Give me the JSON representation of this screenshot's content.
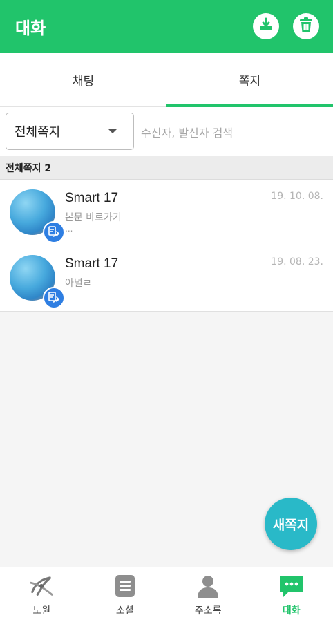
{
  "app_bar": {
    "title": "대화",
    "actions": [
      {
        "name": "download-icon"
      },
      {
        "name": "trash-icon"
      }
    ]
  },
  "tabs": [
    {
      "label": "채팅",
      "active": false
    },
    {
      "label": "쪽지",
      "active": true
    }
  ],
  "filter": {
    "dropdown_value": "전체쪽지",
    "search_placeholder": "수신자, 발신자 검색",
    "search_value": ""
  },
  "section": {
    "label": "전체쪽지 2"
  },
  "messages": [
    {
      "name": "Smart 17",
      "date": "19. 10. 08.",
      "preview": "본문 바로가기",
      "extra": "..."
    },
    {
      "name": "Smart 17",
      "date": "19. 08. 23.",
      "preview": "아녈ㄹ",
      "extra": ""
    }
  ],
  "fab": {
    "label": "새쪽지"
  },
  "bottom_nav": [
    {
      "label": "노원",
      "icon": "nowon-logo-icon",
      "active": false
    },
    {
      "label": "소셜",
      "icon": "document-icon",
      "active": false
    },
    {
      "label": "주소록",
      "icon": "person-icon",
      "active": false
    },
    {
      "label": "대화",
      "icon": "chat-icon",
      "active": true
    }
  ],
  "colors": {
    "accent": "#21c46b",
    "fab": "#29b9c8",
    "badge": "#2e7ee2"
  }
}
